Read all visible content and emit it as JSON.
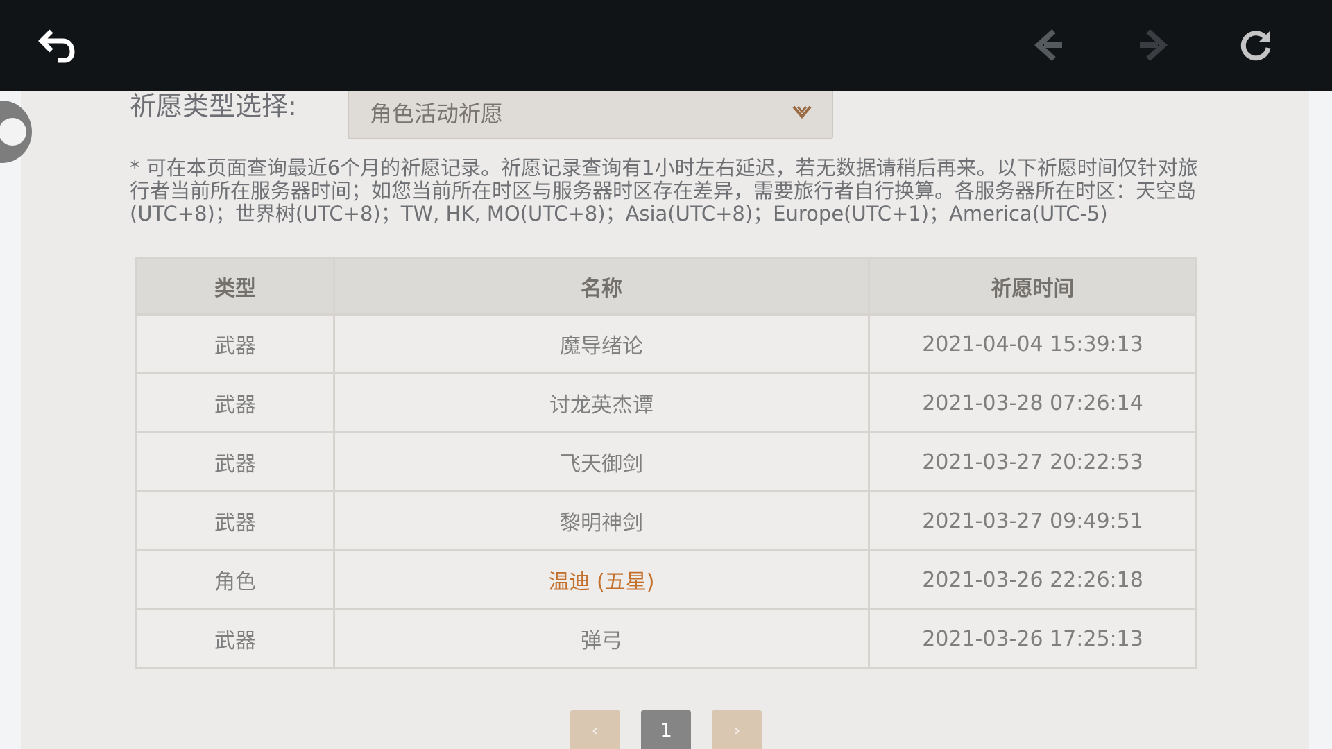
{
  "topbar": {
    "back_icon": "back-arrow-icon",
    "prev_icon": "previous-page-icon",
    "next_icon": "next-page-icon",
    "refresh_icon": "refresh-icon"
  },
  "filter": {
    "label": "祈愿类型选择:",
    "selected": "角色活动祈愿"
  },
  "notice": "* 可在本页面查询最近6个月的祈愿记录。祈愿记录查询有1小时左右延迟，若无数据请稍后再来。以下祈愿时间仅针对旅行者当前所在服务器时间；如您当前所在时区与服务器时区存在差异，需要旅行者自行换算。各服务器所在时区：天空岛(UTC+8)；世界树(UTC+8)；TW, HK, MO(UTC+8)；Asia(UTC+8)；Europe(UTC+1)；America(UTC-5)",
  "table": {
    "headers": [
      "类型",
      "名称",
      "祈愿时间"
    ],
    "rows": [
      {
        "type": "武器",
        "name": "魔导绪论",
        "time": "2021-04-04 15:39:13"
      },
      {
        "type": "武器",
        "name": "讨龙英杰谭",
        "time": "2021-03-28 07:26:14"
      },
      {
        "type": "武器",
        "name": "飞天御剑",
        "time": "2021-03-27 20:22:53"
      },
      {
        "type": "武器",
        "name": "黎明神剑",
        "time": "2021-03-27 09:49:51"
      },
      {
        "type": "角色",
        "name": "温迪 (五星)",
        "time": "2021-03-26 22:26:18"
      },
      {
        "type": "武器",
        "name": "弹弓",
        "time": "2021-03-26 17:25:13"
      }
    ]
  },
  "pagination": {
    "prev": "‹",
    "page": "1",
    "next": "›"
  },
  "colors": {
    "highlight": "#c3702c",
    "topbar": "#111416",
    "background": "#ecebea"
  }
}
